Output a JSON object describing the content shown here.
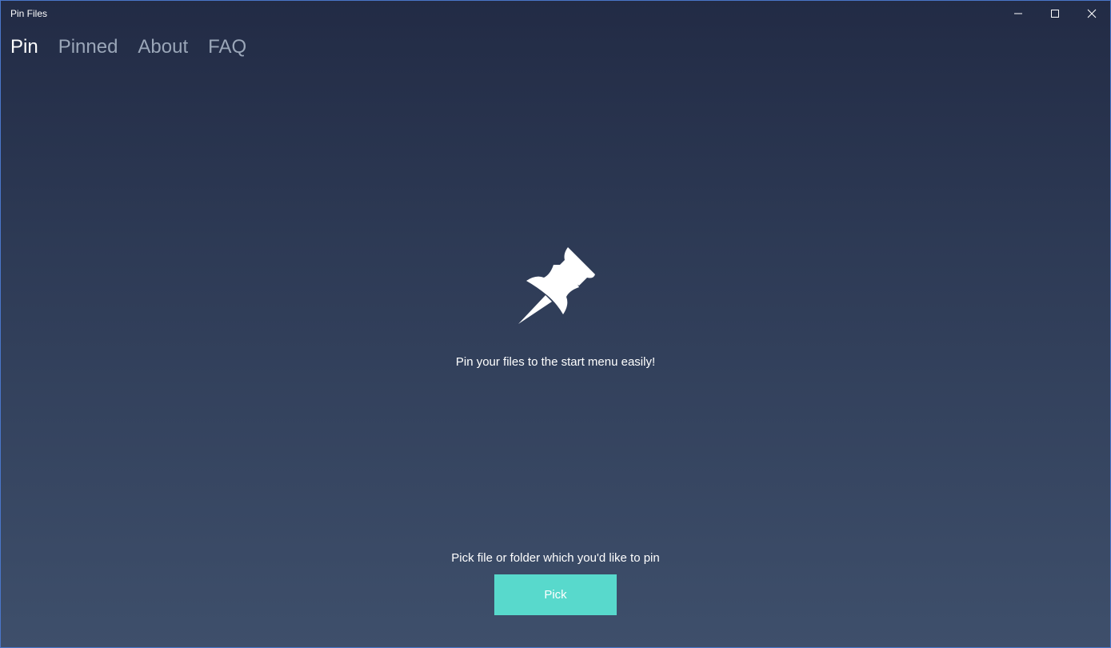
{
  "window": {
    "title": "Pin Files"
  },
  "caption_buttons": {
    "minimize": "minimize-icon",
    "maximize": "maximize-icon",
    "close": "close-icon"
  },
  "nav": {
    "items": [
      {
        "label": "Pin",
        "active": true
      },
      {
        "label": "Pinned",
        "active": false
      },
      {
        "label": "About",
        "active": false
      },
      {
        "label": "FAQ",
        "active": false
      }
    ]
  },
  "main": {
    "icon": "pushpin-icon",
    "tagline": "Pin your files to the start menu easily!",
    "instruction": "Pick file or folder which you'd like to pin",
    "pick_label": "Pick"
  },
  "colors": {
    "accent": "#58d9cc",
    "background_top": "#222b45",
    "background_bottom": "#3e4f6b",
    "nav_inactive": "#9aa6b8",
    "window_border": "#4a76c9"
  }
}
